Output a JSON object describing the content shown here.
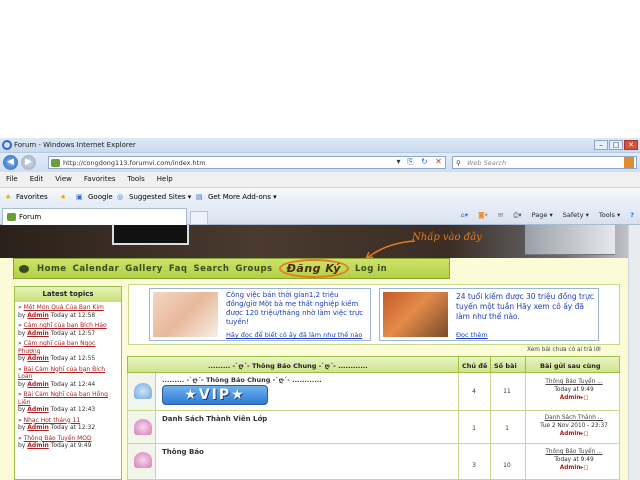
{
  "window": {
    "title": "Forum - Windows Internet Explorer",
    "min": "–",
    "max": "□",
    "close": "✕"
  },
  "address": {
    "url": "http://congdong113.forumvi.com/index.htm",
    "search_placeholder": "Web Search"
  },
  "menu": [
    "File",
    "Edit",
    "View",
    "Favorites",
    "Tools",
    "Help"
  ],
  "favorites": {
    "label": "Favorites",
    "items": [
      "Google",
      "Suggested Sites ▾",
      "Get More Add-ons ▾"
    ]
  },
  "tab": {
    "label": "Forum"
  },
  "commandbar": {
    "page": "Page ▾",
    "safety": "Safety ▾",
    "tools": "Tools ▾",
    "help": "?"
  },
  "banner": {
    "hint": "Nhấp vào đây"
  },
  "nav": {
    "items": [
      "Home",
      "Calendar",
      "Gallery",
      "Faq",
      "Search",
      "Groups",
      "Đăng Ký",
      "Log in"
    ]
  },
  "sidebar": {
    "title": "Latest topics",
    "topics": [
      {
        "title": "Một Món Quà Của Bạn Kim",
        "by": "by",
        "author": "Admin",
        "time": "Today at 12:58"
      },
      {
        "title": "Cảm nghĩ của bạn Bích Hảo",
        "by": "by",
        "author": "Admin",
        "time": "Today at 12:57"
      },
      {
        "title": "Cảm nghĩ của bạn Ngọc Phương",
        "by": "by",
        "author": "Admin",
        "time": "Today at 12:55"
      },
      {
        "title": "Bài Cảm Nghĩ của bạn Bích Loan",
        "by": "by",
        "author": "Admin",
        "time": "Today at 12:44"
      },
      {
        "title": "Bài Cảm Nghĩ của bạn Hồng Liên",
        "by": "by",
        "author": "Admin",
        "time": "Today at 12:43"
      },
      {
        "title": "Nhạc Hot tháng 11",
        "by": "by",
        "author": "Admin",
        "time": "Today at 12:32"
      },
      {
        "title": "Thông Báo Tuyển MOD",
        "by": "by",
        "author": "Admin",
        "time": "Today at 9:49"
      }
    ]
  },
  "ads": [
    {
      "text": "Công việc bán thời gian1,2 triệu đồng/giờ Một bà mẹ thất nghiệp kiếm được 120 triệu/tháng nhờ làm việc trực tuyến!",
      "link": "Hãy đọc để biết cô ấy đã làm như thế nào"
    },
    {
      "text": "24 tuổi kiếm được 30 triệu đồng trực tuyến một tuần Hãy xem cô ấy đã làm như thế nào.",
      "link": "Đọc thêm"
    }
  ],
  "unread_link": "Xem bài chưa có ai trả lời",
  "forum": {
    "header": {
      "section": "......... -`ღ´- Thông Báo Chung -`ღ´- ............",
      "topics": "Chủ đề",
      "posts": "Số bài",
      "last": "Bài gửi sau cùng"
    },
    "rows": [
      {
        "title": "......... -`ღ´- Thông Báo Chung -`ღ´- ............",
        "vip": "VIP",
        "topics": "4",
        "posts": "11",
        "last_title": "Thông Báo Tuyển ...",
        "last_time": "Today at 9:49",
        "last_author": "Admin"
      },
      {
        "title": "Danh Sách Thành Viên Lớp",
        "topics": "1",
        "posts": "1",
        "last_title": "Danh Sách Thành ...",
        "last_time": "Tue 2 Nov 2010 - 23:37",
        "last_author": "Admin"
      },
      {
        "title": "Thông Báo",
        "topics": "3",
        "posts": "10",
        "last_title": "Thông Báo Tuyển ...",
        "last_time": "Today at 9:49",
        "last_author": "Admin"
      }
    ]
  },
  "colors": {
    "accent": "#e57b1f",
    "nav_bg": "#b3cf46",
    "link": "#b02020",
    "page_bg": "#fbfbd8"
  }
}
